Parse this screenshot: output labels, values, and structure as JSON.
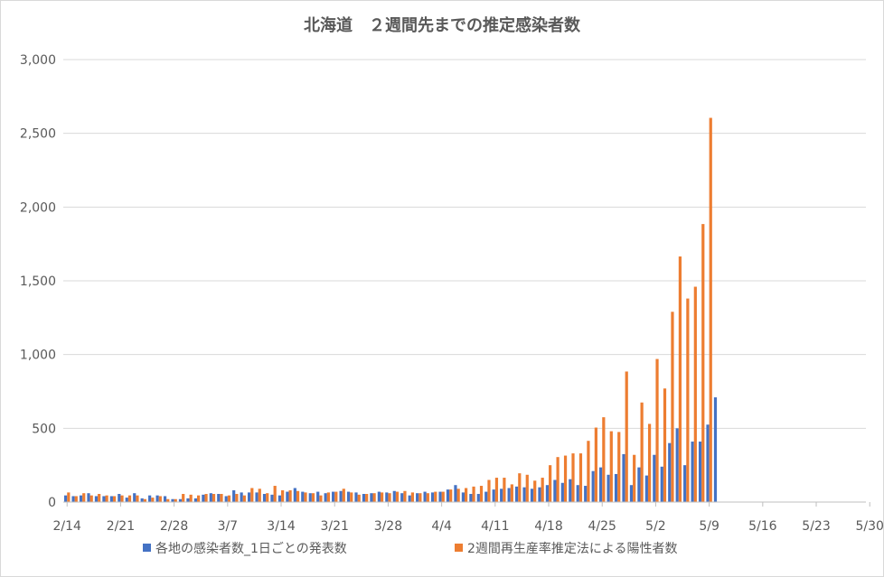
{
  "chart_data": {
    "type": "bar",
    "title": "北海道　２週間先までの推定感染者数",
    "xlabel": "",
    "ylabel": "",
    "ylim": [
      0,
      3000
    ],
    "y_ticks": [
      0,
      500,
      1000,
      1500,
      2000,
      2500,
      3000
    ],
    "y_tick_labels": [
      "0",
      "500",
      "1,000",
      "1,500",
      "2,000",
      "2,500",
      "3,000"
    ],
    "grid": true,
    "legend_position": "bottom",
    "start_date": "2/14",
    "x_tick_labels": [
      "2/14",
      "2/21",
      "2/28",
      "3/7",
      "3/14",
      "3/21",
      "3/28",
      "4/4",
      "4/11",
      "4/18",
      "4/25",
      "5/2",
      "5/9",
      "5/16",
      "5/23",
      "5/30"
    ],
    "series": [
      {
        "name": "各地の感染者数_1日ごとの発表数",
        "color": "#4472C4",
        "values": [
          45,
          40,
          45,
          60,
          40,
          40,
          40,
          55,
          30,
          60,
          25,
          45,
          45,
          40,
          20,
          20,
          25,
          25,
          50,
          60,
          55,
          40,
          80,
          65,
          65,
          65,
          55,
          50,
          45,
          70,
          95,
          70,
          60,
          70,
          60,
          70,
          75,
          70,
          65,
          55,
          60,
          70,
          65,
          75,
          60,
          45,
          60,
          70,
          65,
          70,
          85,
          115,
          65,
          55,
          55,
          70,
          85,
          90,
          95,
          105,
          100,
          90,
          100,
          115,
          150,
          130,
          155,
          115,
          110,
          210,
          235,
          185,
          190,
          325,
          115,
          235,
          180,
          320,
          240,
          400,
          500,
          250,
          410,
          410,
          525,
          710
        ]
      },
      {
        "name": "2週間再生産率推定法による陽性者数",
        "color": "#ED7D31",
        "values": [
          65,
          40,
          60,
          45,
          55,
          45,
          40,
          45,
          45,
          45,
          20,
          30,
          40,
          20,
          20,
          55,
          50,
          45,
          55,
          55,
          55,
          45,
          55,
          45,
          95,
          90,
          60,
          110,
          80,
          80,
          75,
          65,
          60,
          45,
          65,
          70,
          90,
          65,
          50,
          55,
          60,
          65,
          60,
          70,
          75,
          65,
          60,
          60,
          70,
          70,
          85,
          90,
          95,
          105,
          110,
          150,
          165,
          165,
          120,
          195,
          185,
          145,
          165,
          250,
          305,
          315,
          330,
          330,
          415,
          505,
          575,
          480,
          475,
          885,
          320,
          675,
          530,
          970,
          770,
          1290,
          1665,
          1380,
          1460,
          1885,
          2605
        ]
      }
    ]
  }
}
